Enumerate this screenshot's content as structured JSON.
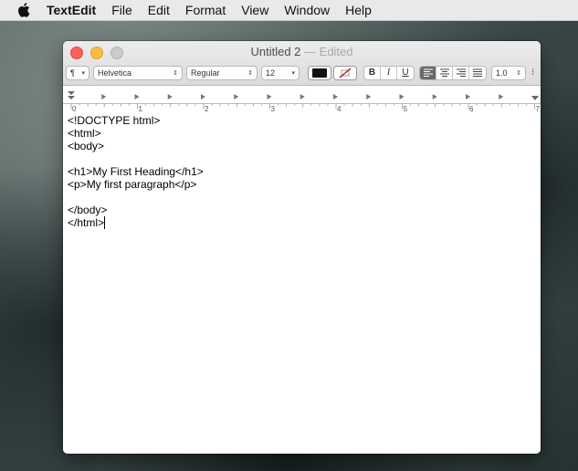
{
  "menubar": {
    "apple_icon": "apple-logo-icon",
    "app_name": "TextEdit",
    "items": [
      "File",
      "Edit",
      "Format",
      "View",
      "Window",
      "Help"
    ]
  },
  "window": {
    "title": "Untitled 2",
    "edited_suffix": "— Edited",
    "toolbar": {
      "paragraph_style": "¶",
      "font_family": "Helvetica",
      "font_style": "Regular",
      "font_size": "12",
      "line_spacing": "1.0",
      "bold_label": "B",
      "italic_label": "I",
      "underline_label": "U",
      "text_color": "#111111",
      "alignments": [
        "align-left-icon",
        "align-center-icon",
        "align-right-icon",
        "align-justify-icon"
      ],
      "active_alignment": "align-left-icon"
    },
    "ruler": {
      "numbers": [
        "0",
        "1",
        "2",
        "3",
        "4",
        "5",
        "6",
        "7"
      ]
    },
    "document": {
      "lines": [
        "<!DOCTYPE html>",
        "<html>",
        "<body>",
        "",
        "<h1>My First Heading</h1>",
        "<p>My first paragraph</p>",
        "",
        "</body>",
        "</html>"
      ]
    }
  },
  "colors": {
    "close": "#fc605c",
    "minimize": "#fdbc40",
    "zoom_disabled": "#cccccc",
    "active_segment": "#6a6a6a"
  }
}
